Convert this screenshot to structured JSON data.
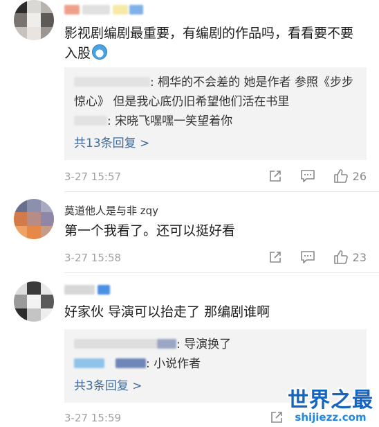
{
  "comments": [
    {
      "username": "",
      "text": "影视剧编剧最重要，有编剧的作品吗，看看要不要入股",
      "replies": [
        {
          "author": "",
          "text": ": 桐华的不会差的 她是作者  参照《步步惊心》 但是我心底仍旧希望他们活在书里"
        },
        {
          "author": "",
          "text": ": 宋晓飞嘿嘿一笑望着你"
        }
      ],
      "more_replies": "共13条回复 >",
      "time": "3-27 15:57",
      "like_count": "26"
    },
    {
      "username": "莫道他人是与非 zqy",
      "text": "第一个我看了。还可以挺好看",
      "time": "3-27 15:58",
      "like_count": "23"
    },
    {
      "username": "",
      "text": "好家伙 导演可以抬走了 那编剧谁啊",
      "replies": [
        {
          "author": "",
          "text": ": 导演换了"
        },
        {
          "author": "",
          "text": ": 小说作者"
        }
      ],
      "more_replies": "共3条回复 >",
      "time": "3-27 15:59",
      "like_count": ""
    }
  ],
  "watermark": {
    "title": "世界之最",
    "url": "shijiezz.com"
  },
  "icons": {
    "share": "share-icon",
    "comment": "comment-icon",
    "like": "thumbs-up-icon"
  }
}
